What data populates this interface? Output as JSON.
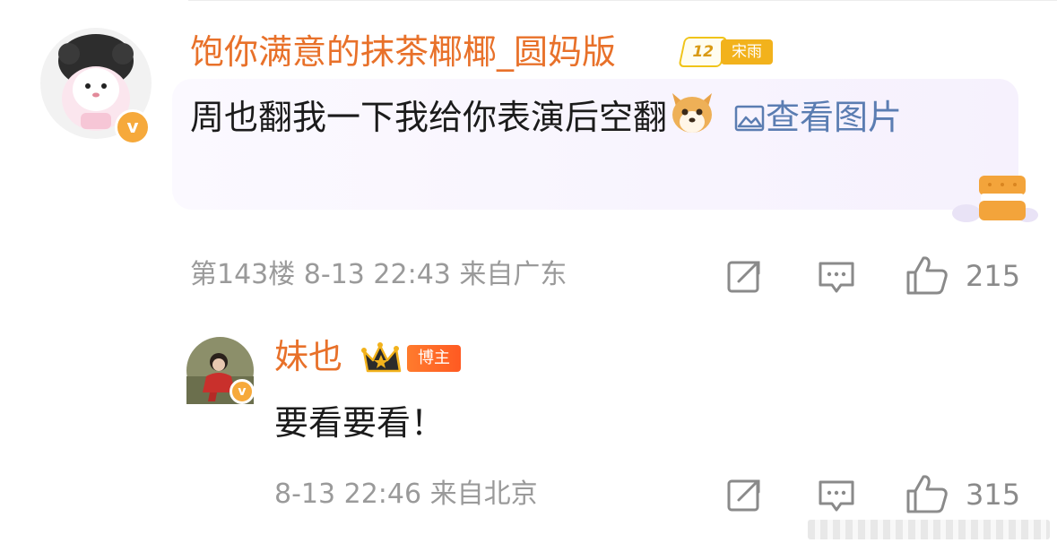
{
  "comment": {
    "username": "饱你满意的抹茶椰椰_圆妈版",
    "level_badge": {
      "level": "12",
      "tag": "宋雨"
    },
    "text": "周也翻我一下我给你表演后空翻",
    "emoji": "dog-face",
    "view_image_link": "查看图片",
    "meta": "第143楼 8-13 22:43 来自广东",
    "likes": "215"
  },
  "reply": {
    "username": "妹也",
    "role_badge": "博主",
    "text": "要看要看！",
    "meta": "8-13 22:46 来自北京",
    "likes": "315"
  },
  "verified_badge_glyph": "v",
  "icons": [
    "share-icon",
    "comment-icon",
    "like-icon",
    "image-icon",
    "crown-icon",
    "verified-icon"
  ],
  "colors": {
    "username": "#e8712a",
    "link": "#5b7db2",
    "meta": "#9a9a9a",
    "verified": "#f6a93b",
    "blogger_badge": "#ff6a28"
  }
}
